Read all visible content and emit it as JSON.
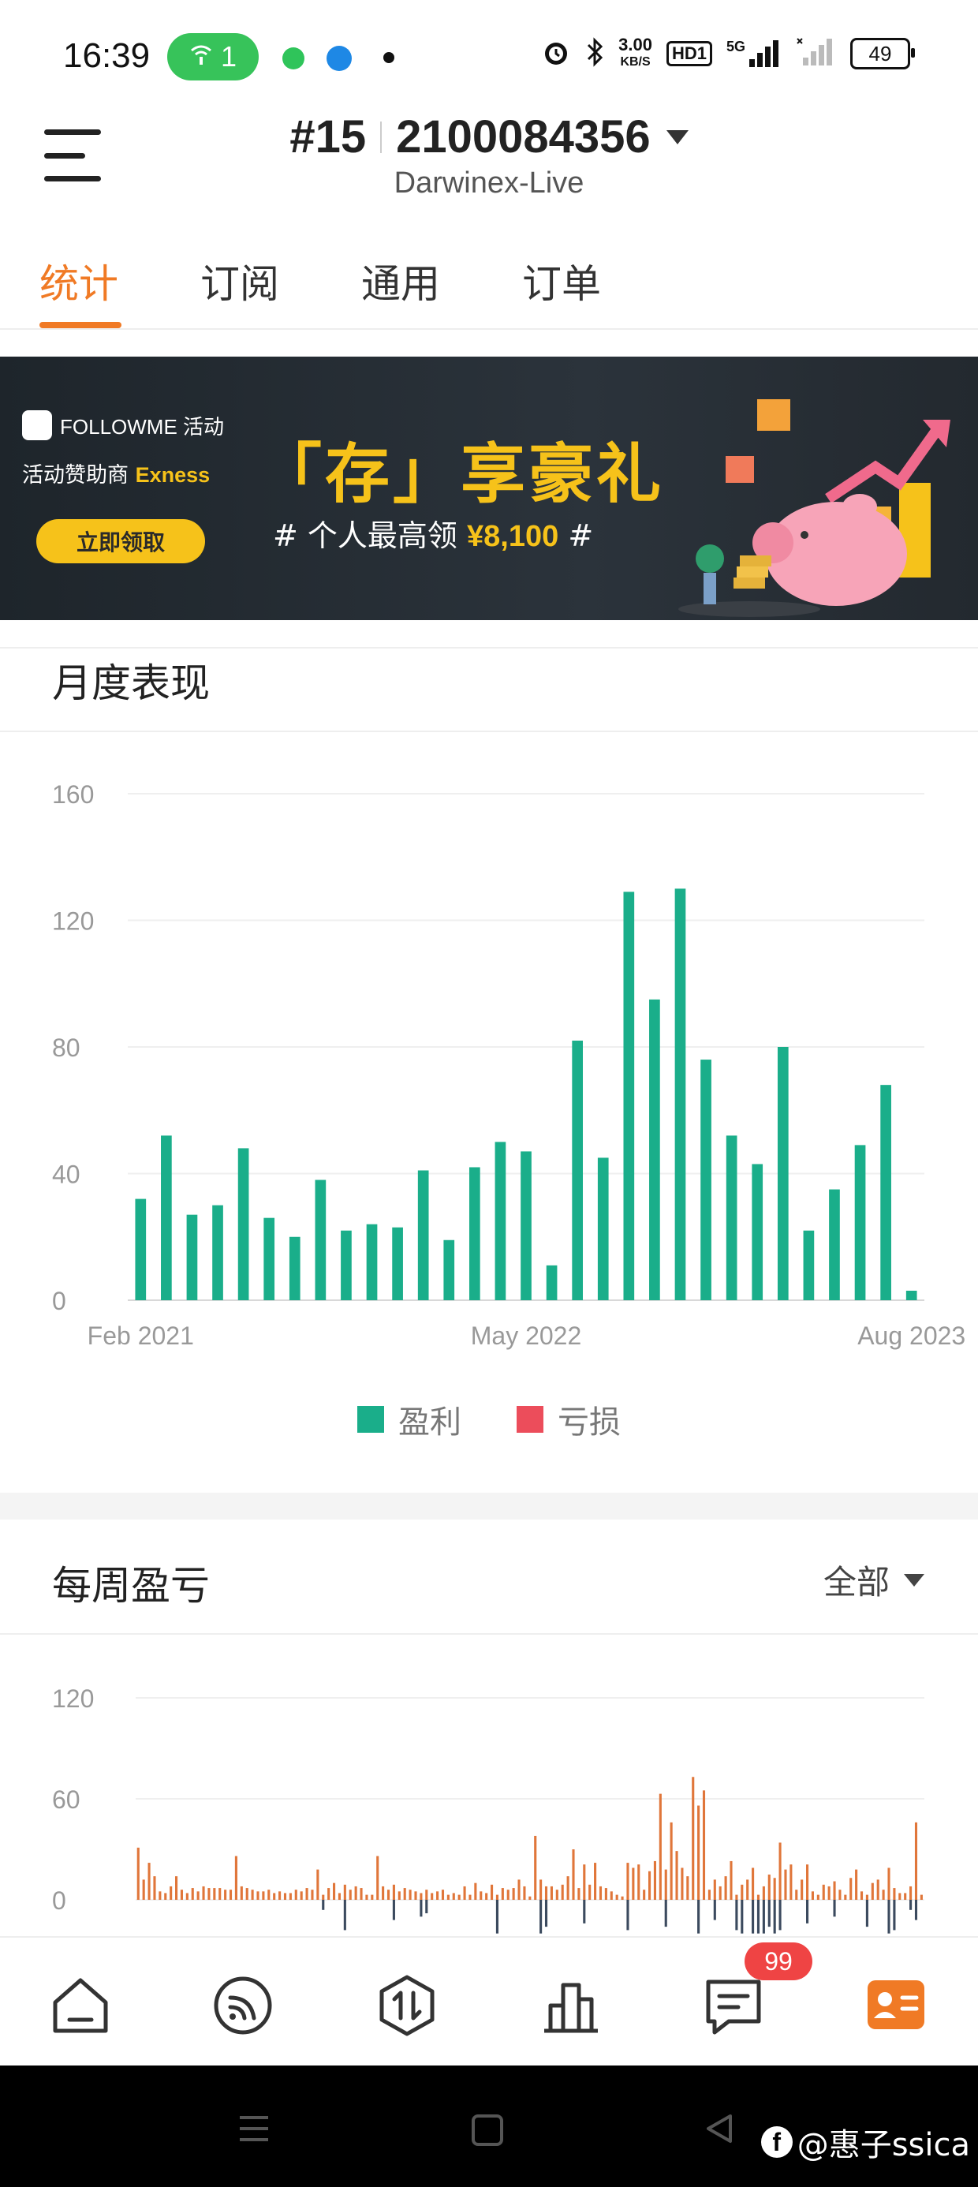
{
  "status_bar": {
    "time": "16:39",
    "wifi_badge": "1",
    "net_speed_value": "3.00",
    "net_speed_unit": "KB/S",
    "hd_label": "HD1",
    "signal_label": "5G",
    "battery": "49"
  },
  "header": {
    "rank": "#15",
    "account_id": "2100084356",
    "server": "Darwinex-Live"
  },
  "tabs": [
    {
      "label": "统计",
      "active": true
    },
    {
      "label": "订阅",
      "active": false
    },
    {
      "label": "通用",
      "active": false
    },
    {
      "label": "订单",
      "active": false
    }
  ],
  "banner": {
    "brand": "FOLLOWME 活动",
    "sponsor_prefix": "活动赞助商",
    "sponsor_name": "Exness",
    "button": "立即领取",
    "headline": "「存」享豪礼",
    "sub_prefix": "# 个人最高领",
    "sub_amount": "¥8,100",
    "sub_suffix": "#"
  },
  "monthly": {
    "title": "月度表现",
    "legend": [
      {
        "label": "盈利",
        "color": "#1aae8a"
      },
      {
        "label": "亏损",
        "color": "#ec4d5b"
      }
    ]
  },
  "weekly": {
    "title": "每周盈亏",
    "filter": "全部"
  },
  "bottom_nav": {
    "items": [
      "home-icon",
      "feed-icon",
      "trade-icon",
      "chart-icon",
      "message-icon",
      "profile-icon"
    ],
    "badge": "99",
    "active_color": "#f07a25"
  },
  "watermark": "@惠子ssica",
  "chart_data": [
    {
      "type": "bar",
      "title": "月度表现",
      "x_tick_labels": [
        "Feb 2021",
        "May 2022",
        "Aug 2023"
      ],
      "y_ticks": [
        0,
        40,
        80,
        120,
        160
      ],
      "ylim": [
        0,
        160
      ],
      "grid": true,
      "legend_position": "bottom",
      "series": [
        {
          "name": "盈利",
          "color": "#1aae8a",
          "values": [
            32,
            52,
            27,
            30,
            48,
            26,
            20,
            38,
            22,
            24,
            23,
            41,
            19,
            42,
            50,
            47,
            11,
            82,
            45,
            129,
            95,
            130,
            76,
            52,
            43,
            80,
            22,
            35,
            49,
            68,
            3
          ]
        },
        {
          "name": "亏损",
          "color": "#ec4d5b",
          "values": []
        }
      ]
    },
    {
      "type": "bar",
      "title": "每周盈亏",
      "y_ticks": [
        0,
        60,
        120
      ],
      "ylim": [
        -20,
        120
      ],
      "grid": true,
      "series": [
        {
          "name": "盈利",
          "color": "#e0763a",
          "values": [
            31,
            12,
            22,
            14,
            5,
            4,
            8,
            14,
            6,
            4,
            7,
            5,
            8,
            7,
            7,
            7,
            6,
            6,
            26,
            8,
            7,
            6,
            5,
            5,
            6,
            4,
            5,
            4,
            4,
            6,
            5,
            7,
            6,
            18,
            3,
            7,
            10,
            4,
            9,
            6,
            8,
            7,
            3,
            3,
            26,
            8,
            6,
            9,
            5,
            7,
            6,
            5,
            4,
            6,
            4,
            5,
            6,
            3,
            4,
            3,
            8,
            3,
            10,
            5,
            4,
            9,
            3,
            7,
            6,
            7,
            12,
            8,
            2,
            38,
            12,
            8,
            8,
            6,
            9,
            14,
            30,
            7,
            21,
            9,
            22,
            8,
            7,
            5,
            3,
            2,
            22,
            19,
            21,
            6,
            17,
            23,
            63,
            18,
            46,
            29,
            19,
            14,
            73,
            56,
            65,
            6,
            12,
            8,
            14,
            23,
            3,
            9,
            12,
            19,
            3,
            8,
            15,
            13,
            34,
            18,
            21,
            6,
            12,
            21,
            5,
            3,
            9,
            8,
            11,
            6,
            3,
            13,
            18,
            5,
            3,
            10,
            12,
            6,
            19,
            7,
            4,
            4,
            8,
            46,
            3
          ]
        },
        {
          "name": "亏损",
          "color": "#3b4a5e",
          "values": [
            0,
            0,
            0,
            0,
            0,
            0,
            0,
            0,
            0,
            0,
            0,
            0,
            0,
            0,
            0,
            0,
            0,
            0,
            0,
            0,
            0,
            0,
            0,
            0,
            0,
            0,
            0,
            0,
            0,
            0,
            0,
            0,
            0,
            0,
            0,
            0,
            0,
            0,
            0,
            0,
            0,
            0,
            0,
            0,
            0,
            0,
            0,
            0,
            0,
            0,
            0,
            0,
            0,
            0,
            0,
            0,
            0,
            0,
            0,
            0,
            0,
            0,
            0,
            0,
            0,
            0,
            0,
            0,
            0,
            0,
            0,
            0,
            0,
            0,
            0,
            0,
            0,
            0,
            0,
            0,
            0,
            0,
            0,
            0,
            0,
            0,
            0,
            0,
            0,
            0,
            0,
            0,
            0,
            0,
            0,
            0,
            0,
            0,
            0,
            0,
            0,
            0,
            0,
            0,
            0,
            0,
            0,
            0,
            0,
            0,
            0,
            0,
            0,
            0,
            0,
            0,
            0,
            0,
            0,
            0,
            0,
            0,
            0,
            0,
            0,
            0,
            0,
            0,
            0,
            0,
            0,
            0,
            0,
            0,
            0,
            0,
            0,
            0,
            0,
            0,
            0,
            0,
            0,
            0,
            0
          ],
          "negative_values": [
            -6,
            -18,
            -12,
            -10,
            -8,
            -20,
            -20,
            -16,
            -14,
            -18,
            -16,
            -20,
            -12,
            -18,
            -20,
            -20,
            -20,
            -20,
            -16,
            -20,
            -18,
            -14,
            -10,
            -16,
            -20,
            -18,
            -6,
            -12
          ]
        }
      ]
    }
  ]
}
